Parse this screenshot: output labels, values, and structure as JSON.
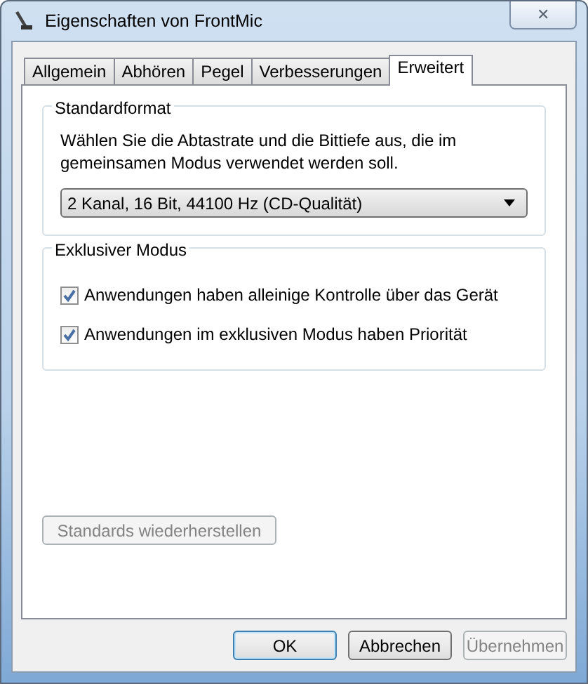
{
  "window": {
    "title": "Eigenschaften von FrontMic",
    "close": "✕"
  },
  "tabs": [
    {
      "label": "Allgemein",
      "selected": false
    },
    {
      "label": "Abhören",
      "selected": false
    },
    {
      "label": "Pegel",
      "selected": false
    },
    {
      "label": "Verbesserungen",
      "selected": false
    },
    {
      "label": "Erweitert",
      "selected": true
    }
  ],
  "standard_format": {
    "title": "Standardformat",
    "description": "Wählen Sie die Abtastrate und die Bittiefe aus, die im gemeinsamen Modus verwendet werden soll.",
    "value": "2 Kanal, 16 Bit, 44100 Hz (CD-Qualität)"
  },
  "exclusive_mode": {
    "title": "Exklusiver Modus",
    "options": [
      {
        "label": "Anwendungen haben alleinige Kontrolle über das Gerät",
        "checked": true
      },
      {
        "label": "Anwendungen im exklusiven Modus haben Priorität",
        "checked": true
      }
    ]
  },
  "restore_button": {
    "label": "Standards wiederherstellen",
    "disabled": true
  },
  "buttons": [
    {
      "label": "OK",
      "disabled": false,
      "default": true
    },
    {
      "label": "Abbrechen",
      "disabled": false,
      "default": false
    },
    {
      "label": "Übernehmen",
      "disabled": true,
      "default": false
    }
  ]
}
